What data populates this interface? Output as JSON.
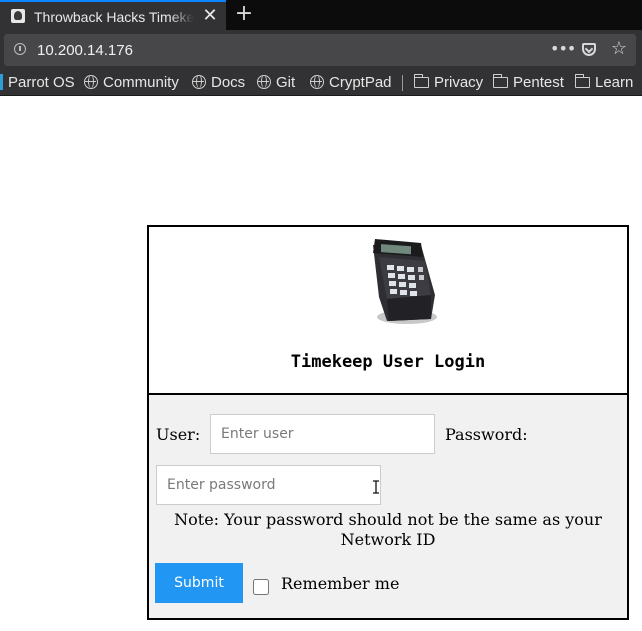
{
  "browser": {
    "tab": {
      "title": "Throwback Hacks Timekeep User Login"
    },
    "address_bar": {
      "url": "10.200.14.176"
    },
    "bookmarks": [
      "Parrot OS",
      "Community",
      "Docs",
      "Git",
      "CryptPad",
      "Privacy",
      "Pentest",
      "Learn"
    ]
  },
  "page": {
    "title": "Timekeep User Login",
    "user_label": "User:",
    "user_placeholder": "Enter user",
    "password_label": "Password:",
    "password_placeholder": "Enter password",
    "note": "Note: Your password should not be the same as your Network ID",
    "submit_label": "Submit",
    "remember_label": "Remember me",
    "remember_checked": false
  },
  "colors": {
    "accent_tab": "#0a84ff",
    "submit_button": "#2196f3",
    "form_background": "#f1f1f1"
  }
}
